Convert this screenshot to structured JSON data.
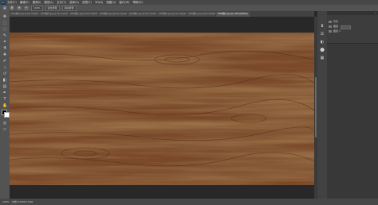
{
  "menubar": {
    "logo": "Ps",
    "items": [
      "文件(F)",
      "编辑(E)",
      "图像(I)",
      "图层(L)",
      "文字(Y)",
      "选择(S)",
      "滤镜(T)",
      "3D(D)",
      "视图(V)",
      "窗口(W)",
      "帮助(H)"
    ]
  },
  "options": {
    "zoom_in_icon": "+",
    "zoom_out_icon": "−",
    "zoom_level": "100%",
    "fit_screen": "适合屏幕",
    "fill_screen": "填充屏幕"
  },
  "tabs": [
    {
      "label": "WPS图片.jpg @ 66.7%(RGB...",
      "active": false
    },
    {
      "label": "WPS图片.jpg @ 66.7%(RGB...",
      "active": false
    },
    {
      "label": "WPS图片.jpg @ 66.7%(RGB...",
      "active": false
    },
    {
      "label": "WPS图片.jpg @ 66.7%(RGB...",
      "active": false
    },
    {
      "label": "WPS图片.jpg @ 66.7%(RGB...",
      "active": false
    },
    {
      "label": "WPS图片.jpg @ 66.7%(RGB...",
      "active": false
    },
    {
      "label": "WPS图片.jpg @ 66.7%(RGB...",
      "active": false
    },
    {
      "label": "WPS图片.jpg @ 100%(RGB/8)",
      "active": true
    }
  ],
  "panel": {
    "collapse": "»",
    "layers": [
      {
        "label": "背景"
      },
      {
        "label": "图层"
      },
      {
        "label": "图层 1"
      }
    ]
  },
  "status": {
    "zoom": "100%",
    "doc_info": "文档:3.23M/3.23M"
  },
  "colors": {
    "wood_base": "#7a4a2a",
    "wood_dark": "#5a3218",
    "wood_light": "#9a6236"
  }
}
